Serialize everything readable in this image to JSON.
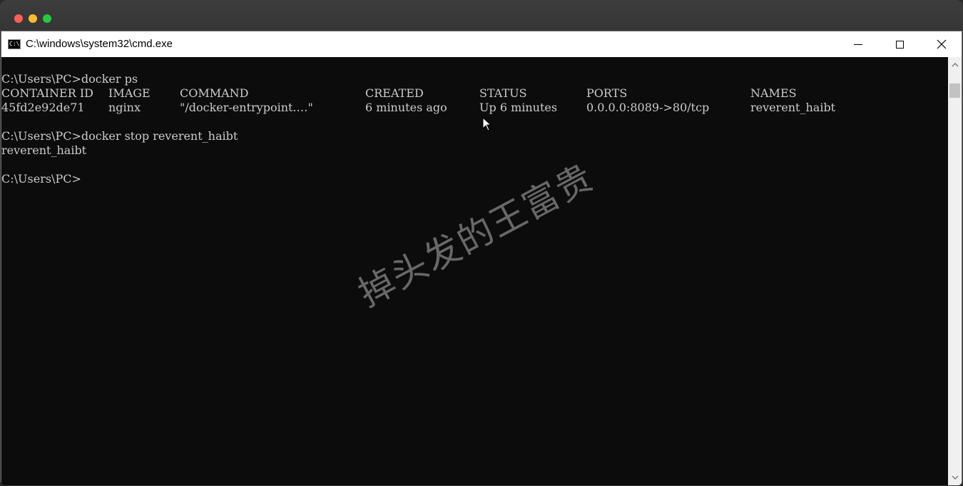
{
  "window": {
    "title": "C:\\windows\\system32\\cmd.exe",
    "icon_text": "C:\\",
    "controls": [
      "minimize",
      "maximize",
      "close"
    ]
  },
  "console": {
    "line1": "C:\\Users\\PC>docker ps",
    "header": {
      "container_id": "CONTAINER ID",
      "image": "IMAGE",
      "command": "COMMAND",
      "created": "CREATED",
      "status": "STATUS",
      "ports": "PORTS",
      "names": "NAMES"
    },
    "row": {
      "container_id": "45fd2e92de71",
      "image": "nginx",
      "command": "\"/docker-entrypoint.…\"",
      "created": "6 minutes ago",
      "status": "Up 6 minutes",
      "ports": "0.0.0.0:8089->80/tcp",
      "names": "reverent_haibt"
    },
    "line4": "C:\\Users\\PC>docker stop reverent_haibt",
    "line5": "reverent_haibt",
    "line6": "C:\\Users\\PC>"
  },
  "watermark": "掉头发的王富贵",
  "colors": {
    "console_bg": "#0c0c0c",
    "console_fg": "#cccccc",
    "titlebar_bg": "#ffffff"
  }
}
